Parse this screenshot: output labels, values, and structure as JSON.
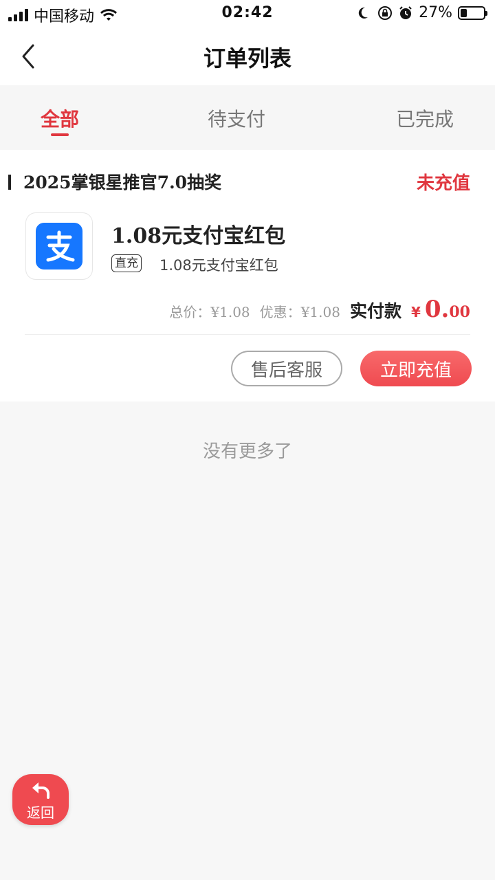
{
  "status_bar": {
    "carrier": "中国移动",
    "time": "02:42",
    "battery_percent": "27%"
  },
  "header": {
    "title": "订单列表"
  },
  "tabs": [
    {
      "label": "全部",
      "active": true
    },
    {
      "label": "待支付",
      "active": false
    },
    {
      "label": "已完成",
      "active": false
    }
  ],
  "order": {
    "store_name": "2025掌银星推官7.0抽奖",
    "status": "未充值",
    "product_title": "1.08元支付宝红包",
    "tag": "直充",
    "product_subtitle": "1.08元支付宝红包",
    "total_price": "总价：¥1.08",
    "discount": "优惠：¥1.08",
    "paid_label": "实付款",
    "currency": "¥",
    "paid_integer": "0.",
    "paid_decimal": "00",
    "buttons": {
      "after_sale": "售后客服",
      "recharge": "立即充值"
    }
  },
  "footer": {
    "no_more": "没有更多了"
  },
  "floating": {
    "back_label": "返回"
  },
  "colors": {
    "accent": "#e0373f",
    "alipay": "#1677ff"
  }
}
